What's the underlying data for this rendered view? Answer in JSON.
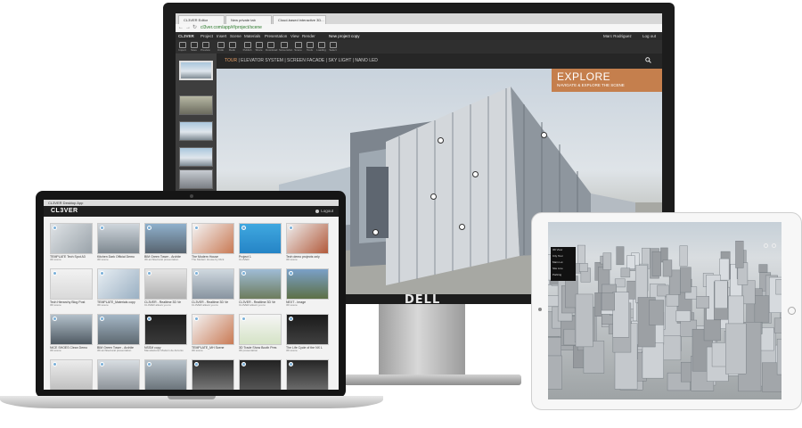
{
  "monitor": {
    "brand": "DELL",
    "browser": {
      "tabs": [
        "CL3VER Editor",
        "New private tab",
        "Cloud-based interactive 3D..."
      ],
      "url": "cl3ver.com/app/#/project/scene"
    },
    "app_menu": [
      "CL3VER",
      "Project",
      "Insert",
      "Scene",
      "Materials",
      "Presentation",
      "View",
      "Render",
      "New project copy"
    ],
    "user": {
      "name": "Marc Rodriguez",
      "logout": "Log out"
    },
    "toolbar": [
      "Import",
      "Save",
      "Preview",
      "Undo",
      "Redo",
      "Publish",
      "Share",
      "Download",
      "Screenshot",
      "Scene",
      "Tools",
      "Loading",
      "Select"
    ],
    "viewer_nav": {
      "tabs": [
        "TOUR",
        "ELEVATOR SYSTEM",
        "SCREEN FACADE",
        "SKY LIGHT",
        "NANO LED"
      ],
      "active": "TOUR"
    },
    "explore": {
      "title": "EXPLORE",
      "subtitle": "NAVIGATE & EXPLORE THE SCENE"
    }
  },
  "laptop": {
    "window_title": "CL3VER Desktop App",
    "logo": "CL3VER",
    "logout": "Logout",
    "projects": [
      {
        "title": "TEMPLATE Tech Spot A3",
        "sub": "3D scene"
      },
      {
        "title": "Kitchen Dark Official Demo",
        "sub": "3D scene"
      },
      {
        "title": "BIM Green Tower - Archite",
        "sub": "3D architectural presentation"
      },
      {
        "title": "The Modern House",
        "sub": "The Modern House by Rick"
      },
      {
        "title": "Project 1",
        "sub": "CL3VER"
      },
      {
        "title": "Tech demo projects only",
        "sub": "3D scene"
      },
      {
        "title": "Tech Hierarchy Blog Post",
        "sub": "3D scene"
      },
      {
        "title": "TEMPLATE_Materials copy",
        "sub": "3D scene"
      },
      {
        "title": "CL3VER - Realtime 3D Ve",
        "sub": "CL3VER allows you to"
      },
      {
        "title": "CL3VER - Realtime 3D Ve",
        "sub": "CL3VER allows you to"
      },
      {
        "title": "CL3VER - Realtime 3D Ve",
        "sub": "CL3VER allows you to"
      },
      {
        "title": "NEXT - Image",
        "sub": "3D scene"
      },
      {
        "title": "NICE SHOES Clean Demo",
        "sub": "3D scene"
      },
      {
        "title": "BIM Green Tower - Archite",
        "sub": "3D architectural presentation"
      },
      {
        "title": "NSSM copy",
        "sub": "Manufacturer Modern de Antonio"
      },
      {
        "title": "TEMPLATE_MH Scene",
        "sub": "3D scene"
      },
      {
        "title": "3D Trade Show Booth Pres",
        "sub": "3D presentation"
      },
      {
        "title": "The Life Cycle of the NX L",
        "sub": "3D scene"
      },
      {
        "title": "Project 7",
        "sub": ""
      },
      {
        "title": "Office tower",
        "sub": ""
      },
      {
        "title": "City block",
        "sub": ""
      },
      {
        "title": "Concept",
        "sub": ""
      },
      {
        "title": "Dark room",
        "sub": ""
      },
      {
        "title": "Product",
        "sub": ""
      }
    ]
  },
  "tablet": {
    "menu": [
      "3D View",
      "City Tour",
      "Main Lot",
      "Site Line",
      "Parking"
    ]
  }
}
